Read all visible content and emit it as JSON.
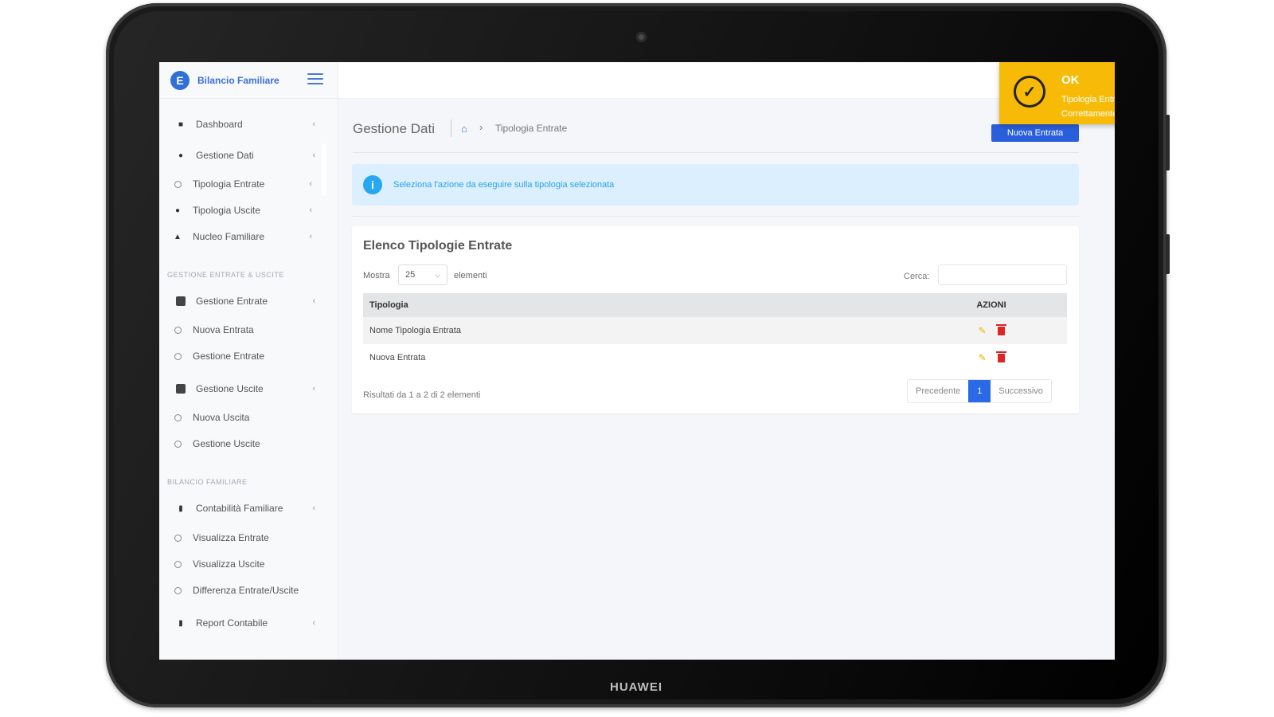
{
  "device": {
    "brand": "HUAWEI"
  },
  "app": {
    "logo_letter": "E",
    "title": "Bilancio Familiare"
  },
  "sidebar": {
    "items": [
      {
        "label": "Dashboard"
      },
      {
        "label": "Gestione Dati"
      },
      {
        "label": "Tipologia Entrate"
      },
      {
        "label": "Tipologia Uscite"
      },
      {
        "label": "Nucleo Familiare"
      },
      {
        "label": "Gestione Entrate"
      },
      {
        "label": "Nuova Entrata"
      },
      {
        "label": "Gestione Entrate"
      },
      {
        "label": "Gestione Uscite"
      },
      {
        "label": "Nuova Uscita"
      },
      {
        "label": "Gestione Uscite"
      },
      {
        "label": "Contabilità Familiare"
      },
      {
        "label": "Visualizza Entrate"
      },
      {
        "label": "Visualizza Uscite"
      },
      {
        "label": "Differenza Entrate/Uscite"
      },
      {
        "label": "Report Contabile"
      }
    ],
    "sections": [
      "GESTIONE ENTRATE & USCITE",
      "BILANCIO FAMILIARE"
    ]
  },
  "header": {
    "page_title": "Gestione Dati",
    "breadcrumb_current": "Tipologia Entrate",
    "new_button": "Nuova Entrata"
  },
  "info": {
    "text": "Seleziona l'azione da eseguire sulla tipologia selezionata"
  },
  "table_card": {
    "title": "Elenco Tipologie Entrate",
    "show_label": "Mostra",
    "show_value": "25",
    "elements_label": "elementi",
    "search_label": "Cerca:",
    "search_value": "",
    "columns": [
      "Tipologia",
      "AZIONI"
    ],
    "rows": [
      {
        "tipologia": "Nome Tipologia Entrata"
      },
      {
        "tipologia": "Nuova Entrata"
      }
    ],
    "results": "Risultati da 1 a 2 di 2 elementi",
    "pager": {
      "prev": "Precedente",
      "page": "1",
      "next": "Successivo"
    }
  },
  "toast": {
    "title": "OK",
    "message": "Tipologia Entrata Modificata Correttamente",
    "close": "×"
  }
}
